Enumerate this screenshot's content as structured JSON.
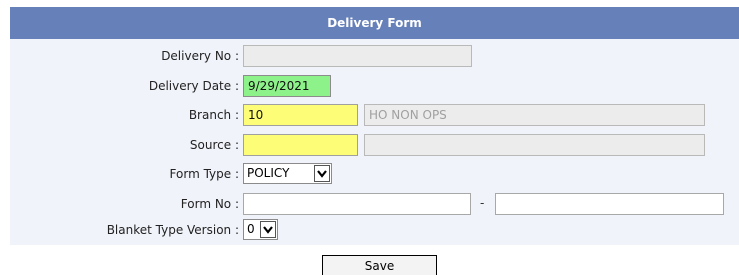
{
  "form": {
    "title": "Delivery Form",
    "delivery_no": {
      "label": "Delivery No :",
      "value": ""
    },
    "delivery_date": {
      "label": "Delivery Date :",
      "value": "9/29/2021"
    },
    "branch": {
      "label": "Branch :",
      "code": "10",
      "name": "HO NON OPS"
    },
    "source": {
      "label": "Source  :",
      "code": "",
      "name": ""
    },
    "form_type": {
      "label": "Form Type :",
      "selected": "POLICY",
      "icon": "chevron-down-icon"
    },
    "form_no": {
      "label": "Form No :",
      "from": "",
      "separator": "-",
      "to": ""
    },
    "blanket_type_version": {
      "label": "Blanket Type Version :",
      "selected": "0",
      "icon": "chevron-down-icon"
    },
    "save_label": "Save"
  },
  "colors": {
    "header": "#6680ba",
    "panel": "#f0f3fa",
    "date_highlight": "#8ef28a",
    "required_highlight": "#fdfd78",
    "readonly": "#ececec"
  }
}
